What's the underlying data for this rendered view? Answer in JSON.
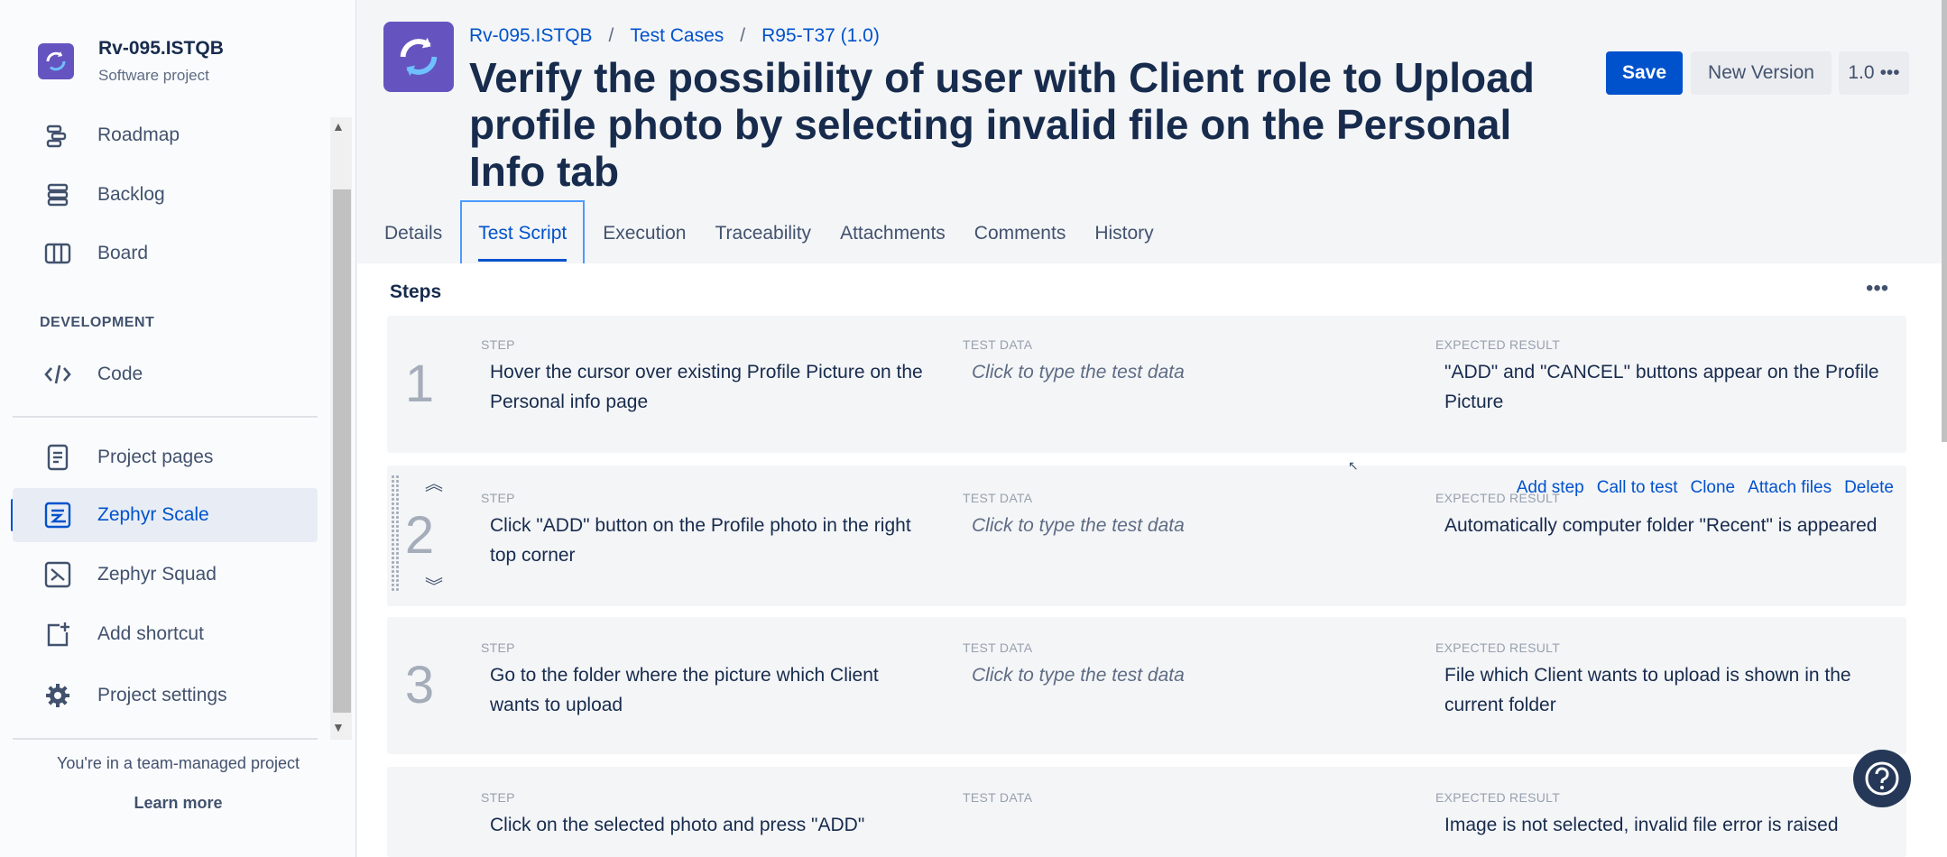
{
  "project": {
    "name": "Rv-095.ISTQB",
    "type": "Software project"
  },
  "sidebar": {
    "items": [
      {
        "label": "Roadmap",
        "icon": "roadmap-icon"
      },
      {
        "label": "Backlog",
        "icon": "backlog-icon"
      },
      {
        "label": "Board",
        "icon": "board-icon"
      },
      {
        "label": "Code",
        "icon": "code-icon"
      },
      {
        "label": "Project pages",
        "icon": "page-icon"
      },
      {
        "label": "Zephyr Scale",
        "icon": "zephyr-scale-icon"
      },
      {
        "label": "Zephyr Squad",
        "icon": "zephyr-squad-icon"
      },
      {
        "label": "Add shortcut",
        "icon": "add-shortcut-icon"
      },
      {
        "label": "Project settings",
        "icon": "gear-icon"
      }
    ],
    "section_development": "DEVELOPMENT",
    "team_note": "You're in a team-managed project",
    "learn_more": "Learn more"
  },
  "breadcrumb": [
    "Rv-095.ISTQB",
    "Test Cases",
    "R95-T37 (1.0)"
  ],
  "title": "Verify the possibility of user with Client role to Upload profile photo by selecting invalid file on the Personal Info tab",
  "buttons": {
    "save": "Save",
    "new_version": "New Version",
    "version": "1.0",
    "more": "•••"
  },
  "tabs": [
    "Details",
    "Test Script",
    "Execution",
    "Traceability",
    "Attachments",
    "Comments",
    "History"
  ],
  "active_tab": "Test Script",
  "steps_section": {
    "title": "Steps",
    "more": "•••"
  },
  "columns": {
    "step": "STEP",
    "test_data": "TEST DATA",
    "expected": "EXPECTED RESULT"
  },
  "step_actions": [
    "Add step",
    "Call to test",
    "Clone",
    "Attach files",
    "Delete"
  ],
  "steps": [
    {
      "num": "1",
      "step": "Hover the cursor over existing Profile Picture on the Personal info page",
      "test_data": "Click to type the test data",
      "expected": "\"ADD\" and \"CANCEL\" buttons appear on the Profile Picture"
    },
    {
      "num": "2",
      "step": "Click \"ADD\" button on the Profile photo in the right top corner",
      "test_data": "Click to type the test data",
      "expected": "Automatically computer folder \"Recent\" is appeared"
    },
    {
      "num": "3",
      "step": "Go to the folder where the picture which Client wants to upload",
      "test_data": "Click to type the test data",
      "expected": "File which Client wants to upload is shown in the current folder"
    },
    {
      "num": "",
      "step": "Click on the selected photo and press \"ADD\"",
      "test_data": "",
      "expected": "Image is not selected, invalid file error is raised"
    }
  ],
  "colors": {
    "accent": "#0052cc",
    "avatar": "#6554c0",
    "help": "#253858"
  }
}
